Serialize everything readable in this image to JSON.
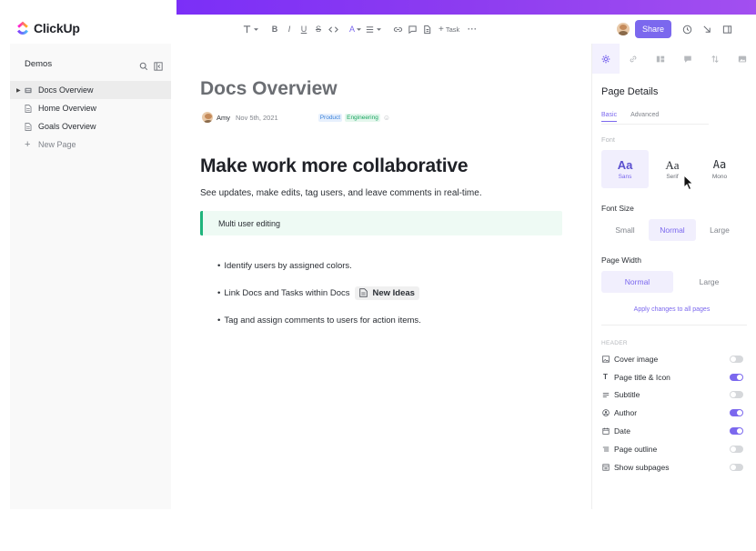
{
  "app": {
    "name": "ClickUp"
  },
  "toolbar": {
    "task_label": "Task",
    "share_label": "Share"
  },
  "sidebar": {
    "title": "Demos",
    "items": [
      {
        "label": "Docs Overview"
      },
      {
        "label": "Home Overview"
      },
      {
        "label": "Goals Overview"
      },
      {
        "label": "New Page"
      }
    ]
  },
  "doc": {
    "title": "Docs Overview",
    "author": "Amy",
    "date": "Nov 5th, 2021",
    "tags": [
      "Product",
      "Engineering"
    ],
    "heading": "Make work more collaborative",
    "subtitle": "See updates, make edits, tag users, and leave comments in real-time.",
    "callout": "Multi user editing",
    "bullets": [
      "Identify users by assigned colors.",
      "Link Docs and Tasks within Docs",
      "Tag and assign comments to users for action items."
    ],
    "linked_doc": "New Ideas"
  },
  "panel": {
    "title": "Page Details",
    "subtabs": [
      "Basic",
      "Advanced"
    ],
    "font_label": "Font",
    "fonts": [
      {
        "glyph": "Aa",
        "name": "Sans"
      },
      {
        "glyph": "Aa",
        "name": "Serif"
      },
      {
        "glyph": "Aa",
        "name": "Mono"
      }
    ],
    "selected_font": "Sans",
    "font_size_label": "Font Size",
    "font_sizes": [
      "Small",
      "Normal",
      "Large"
    ],
    "selected_font_size": "Normal",
    "page_width_label": "Page Width",
    "page_widths": [
      "Normal",
      "Large"
    ],
    "selected_page_width": "Normal",
    "apply_link": "Apply changes to all pages",
    "header_label": "HEADER",
    "toggles": [
      {
        "label": "Cover image",
        "icon": "image-icon",
        "on": false
      },
      {
        "label": "Page title & Icon",
        "icon": "title-icon",
        "on": true
      },
      {
        "label": "Subtitle",
        "icon": "subtitle-icon",
        "on": false
      },
      {
        "label": "Author",
        "icon": "author-icon",
        "on": true
      },
      {
        "label": "Date",
        "icon": "calendar-icon",
        "on": true
      },
      {
        "label": "Page outline",
        "icon": "outline-icon",
        "on": false
      },
      {
        "label": "Show subpages",
        "icon": "subpages-icon",
        "on": false
      }
    ]
  },
  "colors": {
    "accent": "#7b68ee",
    "brand_gradient_start": "#7b2ff7",
    "callout_border": "#1fb47c"
  }
}
